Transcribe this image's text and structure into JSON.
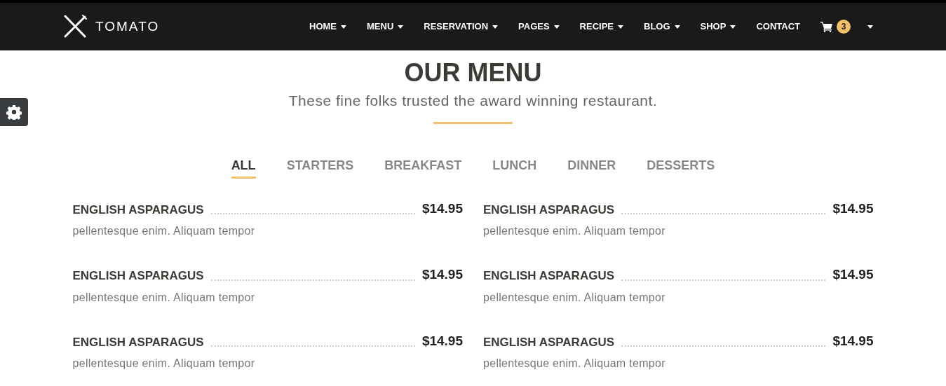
{
  "brand": {
    "name": "TOMATO"
  },
  "nav": [
    {
      "label": "HOME",
      "dropdown": true
    },
    {
      "label": "MENU",
      "dropdown": true
    },
    {
      "label": "RESERVATION",
      "dropdown": true
    },
    {
      "label": "PAGES",
      "dropdown": true
    },
    {
      "label": "RECIPE",
      "dropdown": true
    },
    {
      "label": "BLOG",
      "dropdown": true
    },
    {
      "label": "SHOP",
      "dropdown": true
    },
    {
      "label": "CONTACT",
      "dropdown": false
    }
  ],
  "cart": {
    "count": "3",
    "dropdown": true
  },
  "section": {
    "title": "OUR MENU",
    "subtitle": "These fine folks trusted the award winning restaurant."
  },
  "tabs": [
    {
      "label": "ALL",
      "selected": true
    },
    {
      "label": "STARTERS",
      "selected": false
    },
    {
      "label": "BREAKFAST",
      "selected": false
    },
    {
      "label": "LUNCH",
      "selected": false
    },
    {
      "label": "DINNER",
      "selected": false
    },
    {
      "label": "DESSERTS",
      "selected": false
    }
  ],
  "items": [
    {
      "name": "ENGLISH ASPARAGUS",
      "price": "$14.95",
      "description": "pellentesque enim. Aliquam tempor"
    },
    {
      "name": "ENGLISH ASPARAGUS",
      "price": "$14.95",
      "description": "pellentesque enim. Aliquam tempor"
    },
    {
      "name": "ENGLISH ASPARAGUS",
      "price": "$14.95",
      "description": "pellentesque enim. Aliquam tempor"
    },
    {
      "name": "ENGLISH ASPARAGUS",
      "price": "$14.95",
      "description": "pellentesque enim. Aliquam tempor"
    },
    {
      "name": "ENGLISH ASPARAGUS",
      "price": "$14.95",
      "description": "pellentesque enim. Aliquam tempor"
    },
    {
      "name": "ENGLISH ASPARAGUS",
      "price": "$14.95",
      "description": "pellentesque enim. Aliquam tempor"
    }
  ]
}
